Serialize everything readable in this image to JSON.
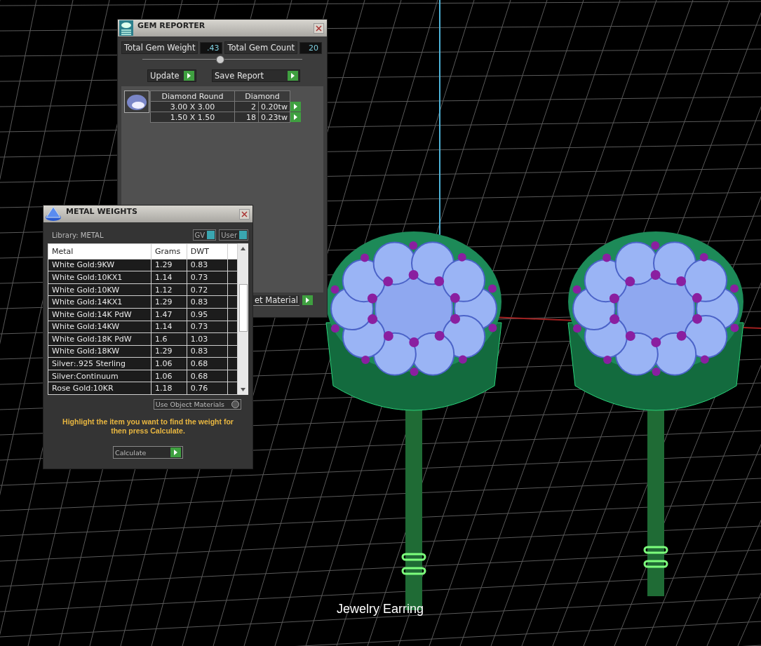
{
  "viewport": {
    "caption": "Jewelry Earring"
  },
  "gem_reporter": {
    "title": "GEM REPORTER",
    "stats": [
      {
        "label": "Total Gem Weight",
        "value": ".43"
      },
      {
        "label": "Total Gem Count",
        "value": "20"
      }
    ],
    "buttons": [
      {
        "label": "Update"
      },
      {
        "label": "Save Report"
      }
    ],
    "gem_table": {
      "shape": "Diamond Round",
      "material": "Diamond",
      "rows": [
        {
          "size": "3.00 X 3.00",
          "count": "2",
          "weight": "0.20tw"
        },
        {
          "size": "1.50 X 1.50",
          "count": "18",
          "weight": "0.23tw"
        }
      ]
    },
    "material_button": "et Material"
  },
  "metal_weights": {
    "title": "METAL WEIGHTS",
    "library": "Library: METAL",
    "toggles": [
      {
        "label": "GV",
        "on": true
      },
      {
        "label": "User",
        "on": true
      }
    ],
    "columns": [
      "Metal",
      "Grams",
      "DWT"
    ],
    "rows": [
      [
        "White Gold:9KW",
        "1.29",
        "0.83"
      ],
      [
        "White Gold:10KX1",
        "1.14",
        "0.73"
      ],
      [
        "White Gold:10KW",
        "1.12",
        "0.72"
      ],
      [
        "White Gold:14KX1",
        "1.29",
        "0.83"
      ],
      [
        "White Gold:14K PdW",
        "1.47",
        "0.95"
      ],
      [
        "White Gold:14KW",
        "1.14",
        "0.73"
      ],
      [
        "White Gold:18K PdW",
        "1.6",
        "1.03"
      ],
      [
        "White Gold:18KW",
        "1.29",
        "0.83"
      ],
      [
        "Silver:.925 Sterling",
        "1.06",
        "0.68"
      ],
      [
        "Silver:Continuum",
        "1.06",
        "0.68"
      ],
      [
        "Rose Gold:10KR",
        "1.18",
        "0.76"
      ]
    ],
    "use_object_materials": {
      "label": "Use Object Materials",
      "checked": false
    },
    "hint": "Highlight the item you want to find the weight for then press Calculate.",
    "calculate": "Calculate"
  }
}
